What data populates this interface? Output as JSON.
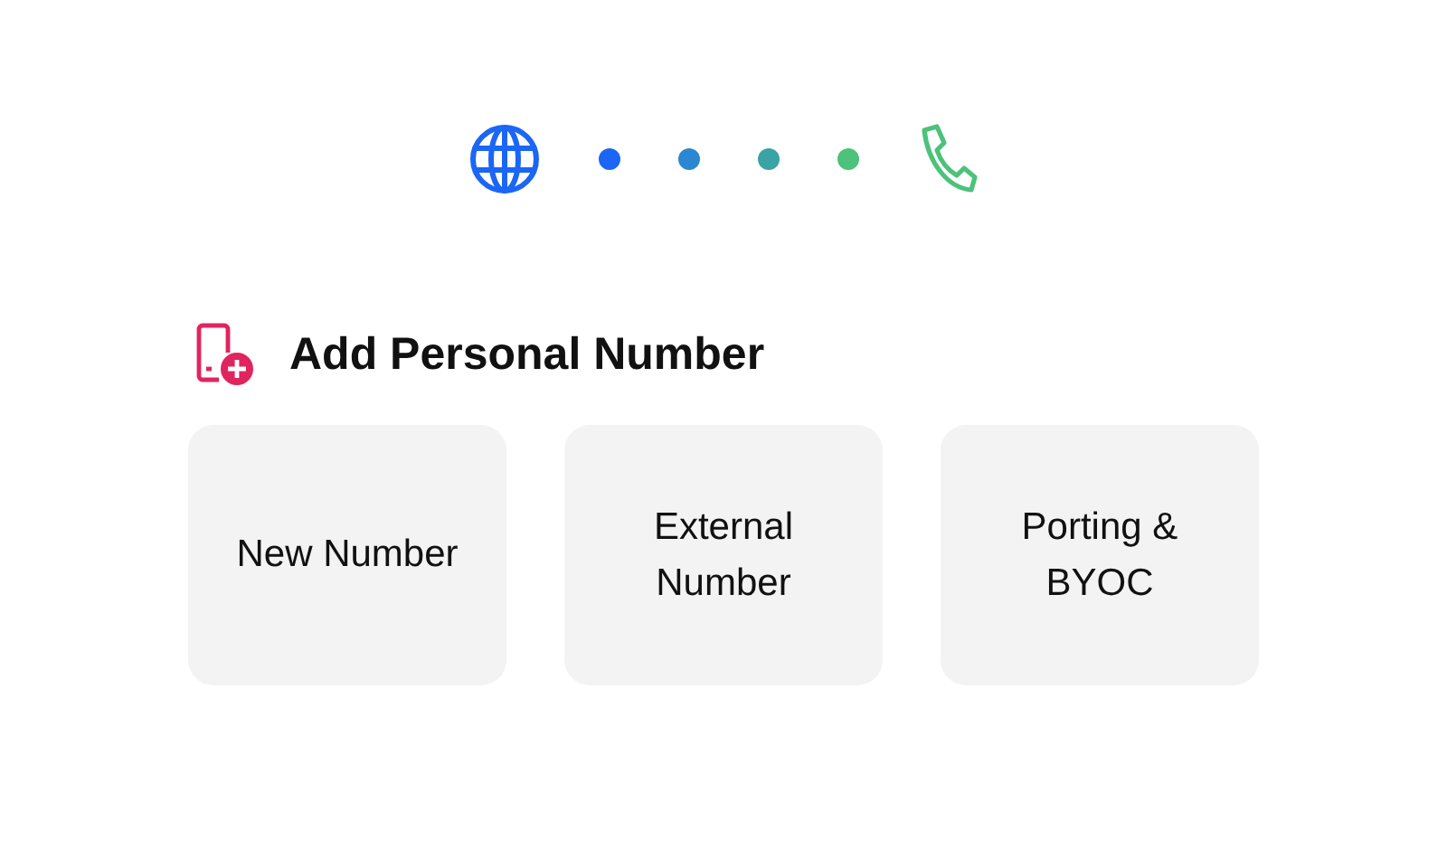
{
  "progress_dots": [
    {
      "color": "#1b66f5"
    },
    {
      "color": "#2b87d1"
    },
    {
      "color": "#39a3a6"
    },
    {
      "color": "#4cc27a"
    }
  ],
  "heading": "Add Personal Number",
  "options": [
    {
      "label": "New Number"
    },
    {
      "label": "External Number"
    },
    {
      "label": "Porting & BYOC"
    }
  ]
}
